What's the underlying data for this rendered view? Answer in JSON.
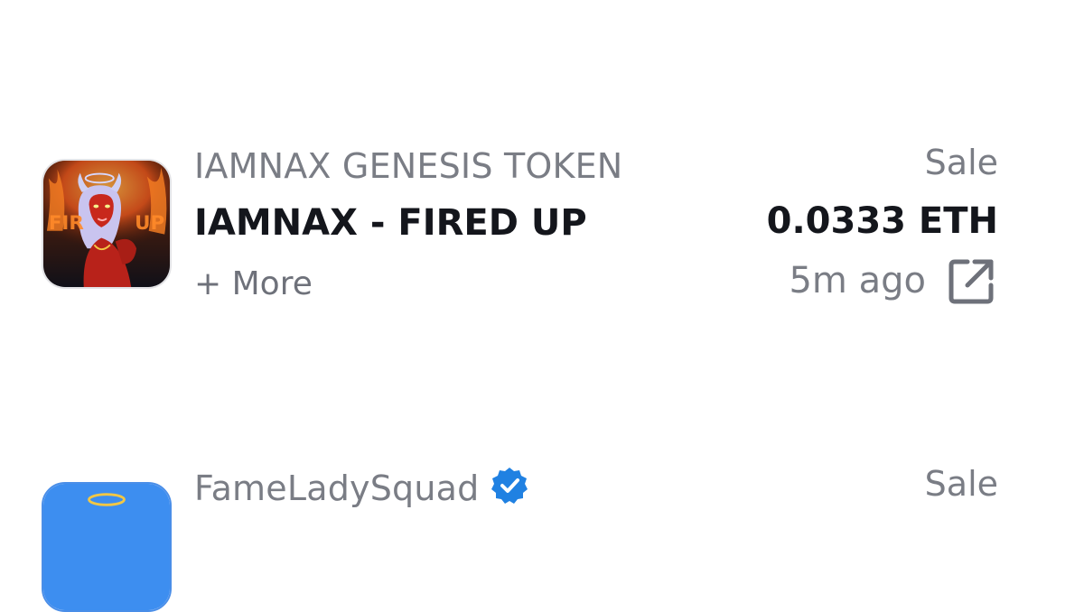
{
  "activity": [
    {
      "collection": "IAMNAX GENESIS TOKEN",
      "item_name": "IAMNAX - FIRED UP",
      "more_label": "+ More",
      "event_type": "Sale",
      "price": "0.0333 ETH",
      "time": "5m ago",
      "verified": false,
      "thumbnail_text": "FIRED UP",
      "link_icon": "external-link-icon"
    },
    {
      "collection": "FameLadySquad",
      "event_type": "Sale",
      "verified": true,
      "verified_icon": "verified-badge-icon"
    }
  ],
  "colors": {
    "muted_text": "#7a7d85",
    "primary_text": "#14161c",
    "verified_blue": "#2081e2"
  }
}
